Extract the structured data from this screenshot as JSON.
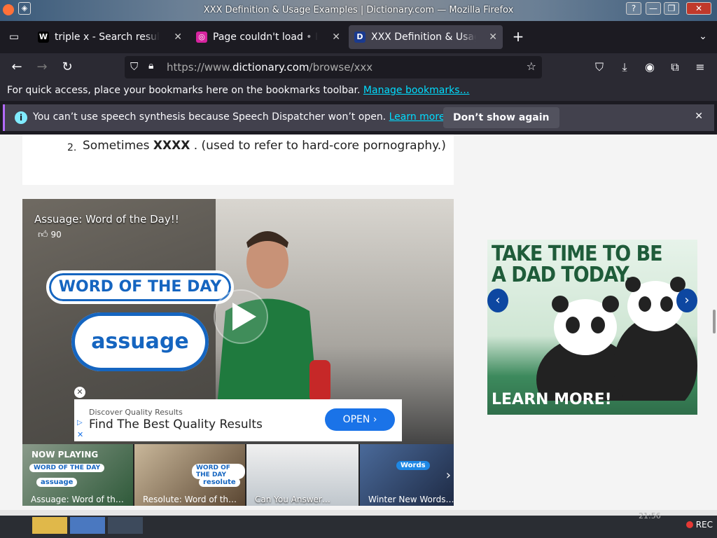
{
  "window": {
    "title": "XXX Definition & Usage Examples | Dictionary.com — Mozilla Firefox",
    "buttons": [
      "?",
      "—",
      "❐",
      "✕"
    ]
  },
  "tabs": [
    {
      "label": "triple x - Search results",
      "favicon": "W",
      "favicon_color": "#ffffff",
      "favicon_bg": "#000000",
      "active": false
    },
    {
      "label": "Page couldn't load • Inst",
      "favicon": "◎",
      "favicon_color": "#ffffff",
      "favicon_bg": "#d6249f",
      "active": false
    },
    {
      "label": "XXX Definition & Usage E",
      "favicon": "D",
      "favicon_color": "#ffffff",
      "favicon_bg": "#1a3a8f",
      "active": true
    }
  ],
  "nav": {
    "url_prefix": "https://www.",
    "url_domain": "dictionary.com",
    "url_path": "/browse/xxx"
  },
  "bookmarks_bar": {
    "text": "For quick access, place your bookmarks here on the bookmarks toolbar.",
    "link": "Manage bookmarks…"
  },
  "notification": {
    "message": "You can’t use speech synthesis because Speech Dispatcher won’t open.",
    "learn_more": "Learn more",
    "dismiss": "Don’t show again"
  },
  "definition": {
    "number": "2.",
    "prefix": "Sometimes",
    "term": "XXXX",
    "suffix": ". (used to refer to hard-core pornography.)"
  },
  "video": {
    "title": "Assuage: Word of the Day!!",
    "likes": "90",
    "badge": "WORD OF THE DAY",
    "word": "assuage"
  },
  "video_ad": {
    "sub": "Discover Quality Results",
    "headline": "Find The Best Quality Results",
    "button": "OPEN"
  },
  "playlist": {
    "now_playing": "NOW PLAYING",
    "items": [
      {
        "caption": "Assuage: Word of th…",
        "badge": "WORD OF THE DAY",
        "word": "assuage"
      },
      {
        "caption": "Resolute: Word of th…",
        "badge": "WORD OF THE DAY",
        "word": "resolute"
      },
      {
        "caption": "Can You Answer…"
      },
      {
        "caption": "Winter New Words…",
        "tag": "Words"
      }
    ]
  },
  "side_ad": {
    "headline_1": "TAKE TIME TO BE",
    "headline_2": "A DAD TODAY.",
    "cta": "LEARN MORE!"
  },
  "taskbar": {
    "clock": "21:56",
    "rec": "REC"
  }
}
